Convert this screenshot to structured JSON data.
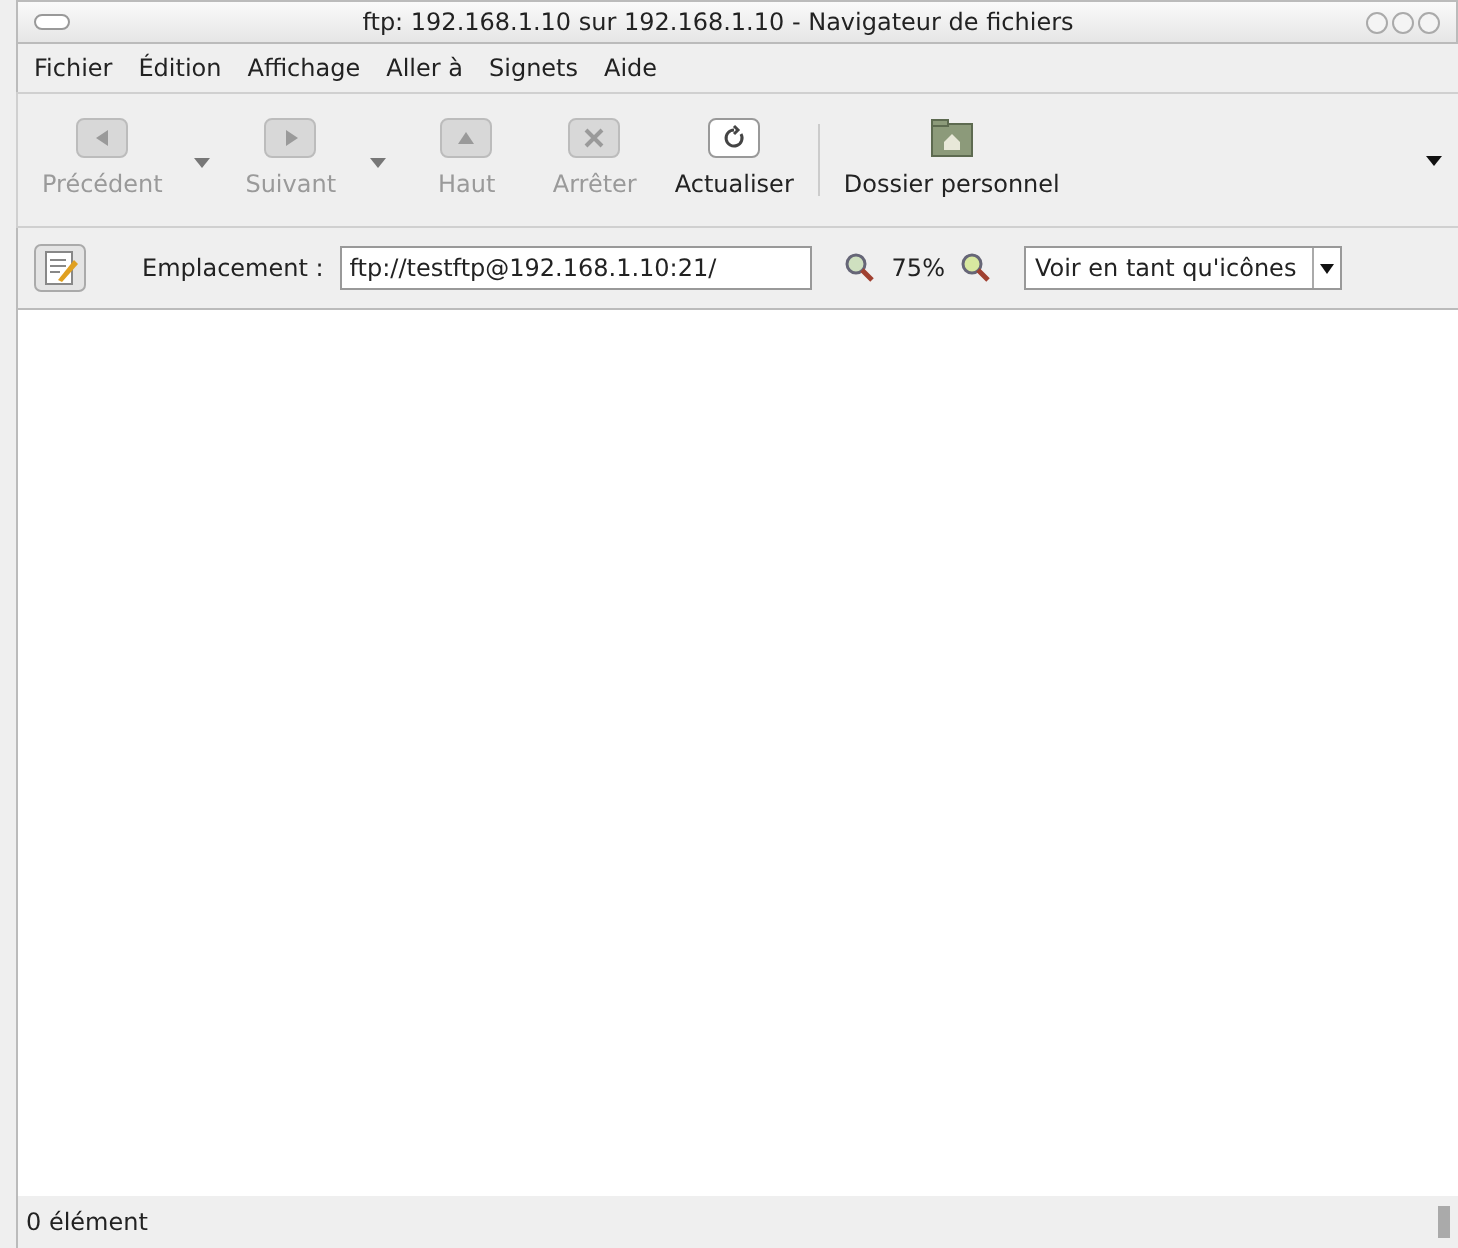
{
  "window": {
    "title": "ftp: 192.168.1.10 sur 192.168.1.10 - Navigateur de fichiers"
  },
  "menu": [
    "Fichier",
    "Édition",
    "Affichage",
    "Aller à",
    "Signets",
    "Aide"
  ],
  "toolbar": [
    {
      "kind": "back",
      "label": "Précédent",
      "disabled": true,
      "dropdown": true
    },
    {
      "kind": "forward",
      "label": "Suivant",
      "disabled": true,
      "dropdown": true
    },
    {
      "kind": "up",
      "label": "Haut",
      "disabled": true,
      "dropdown": false
    },
    {
      "kind": "stop",
      "label": "Arrêter",
      "disabled": true,
      "dropdown": false
    },
    {
      "kind": "reload",
      "label": "Actualiser",
      "disabled": false,
      "dropdown": false
    },
    {
      "kind": "home",
      "label": "Dossier personnel",
      "disabled": false,
      "dropdown": false
    }
  ],
  "location": {
    "label": "Emplacement :",
    "value": "ftp://testftp@192.168.1.10:21/",
    "zoom": "75%",
    "view": "Voir en tant qu'icônes"
  },
  "status_bar": "0 élément"
}
